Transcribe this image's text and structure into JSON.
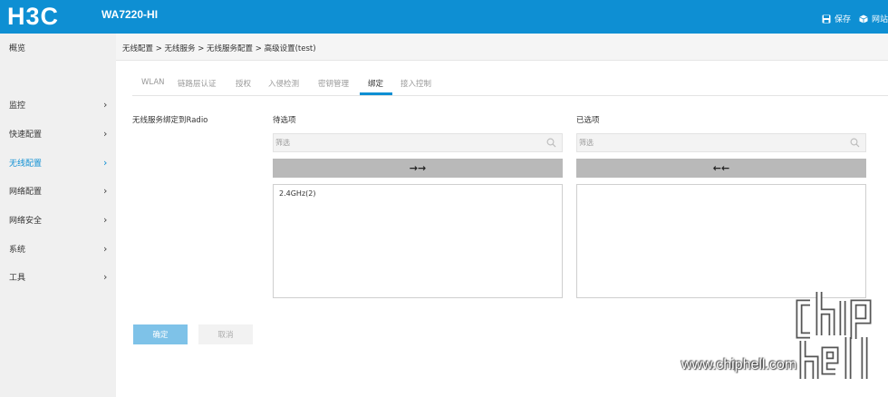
{
  "header": {
    "brand": "H3C",
    "model": "WA7220-HI",
    "actions": [
      {
        "label": "保存",
        "icon": "save-icon"
      },
      {
        "label": "网站",
        "icon": "cube-icon"
      }
    ]
  },
  "sidebar": {
    "items": [
      {
        "label": "概览",
        "has_chevron": false,
        "active": false
      },
      {
        "label": "监控",
        "has_chevron": true,
        "active": false
      },
      {
        "label": "快速配置",
        "has_chevron": true,
        "active": false
      },
      {
        "label": "无线配置",
        "has_chevron": true,
        "active": true
      },
      {
        "label": "网络配置",
        "has_chevron": true,
        "active": false
      },
      {
        "label": "网络安全",
        "has_chevron": true,
        "active": false
      },
      {
        "label": "系统",
        "has_chevron": true,
        "active": false
      },
      {
        "label": "工具",
        "has_chevron": true,
        "active": false
      }
    ],
    "chevron": "›"
  },
  "breadcrumb": "无线配置 > 无线服务 > 无线服务配置 > 高级设置(test)",
  "tabs": [
    "WLAN",
    "链路层认证",
    "授权",
    "入侵检测",
    "密钥管理",
    "绑定",
    "接入控制"
  ],
  "active_tab": "绑定",
  "binding": {
    "row_label": "无线服务绑定到Radio",
    "available": {
      "title": "待选项",
      "filter_placeholder": "筛选",
      "move_label": "→→",
      "items": [
        "2.4GHz(2)"
      ]
    },
    "selected": {
      "title": "已选项",
      "filter_placeholder": "筛选",
      "move_label": "←←",
      "items": []
    }
  },
  "buttons": {
    "ok": "确定",
    "cancel": "取消"
  },
  "watermark": {
    "url": "www.chiphell.com",
    "logo_text": "chip hell"
  },
  "colors": {
    "accent": "#0e8fd3",
    "ok_button": "#7ec2e8",
    "move_button": "#b9b9b9"
  }
}
